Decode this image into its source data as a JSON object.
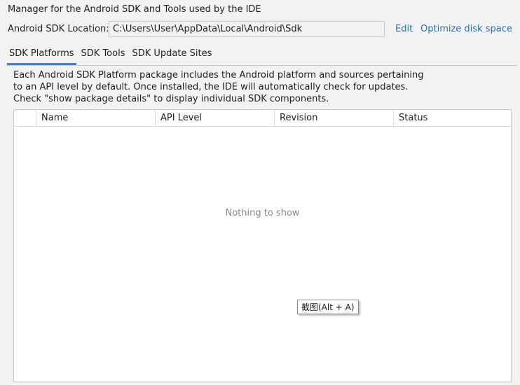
{
  "header": {
    "description": "Manager for the Android SDK and Tools used by the IDE",
    "location_label": "Android SDK Location:",
    "location_value": "C:\\Users\\User\\AppData\\Local\\Android\\Sdk",
    "edit_link": "Edit",
    "optimize_link": "Optimize disk space"
  },
  "tabs": [
    {
      "label": "SDK Platforms",
      "active": true
    },
    {
      "label": "SDK Tools",
      "active": false
    },
    {
      "label": "SDK Update Sites",
      "active": false
    }
  ],
  "platforms": {
    "info_text": "Each Android SDK Platform package includes the Android platform and sources pertaining to an API level by default. Once installed, the IDE will automatically check for updates. Check \"show package details\" to display individual SDK components.",
    "columns": [
      "Name",
      "API Level",
      "Revision",
      "Status"
    ],
    "empty_text": "Nothing to show"
  },
  "tooltip": {
    "text": "截图(Alt + A)"
  },
  "colors": {
    "link": "#2470b3",
    "tab_indicator": "#4083c9",
    "background": "#f2f2f2"
  }
}
